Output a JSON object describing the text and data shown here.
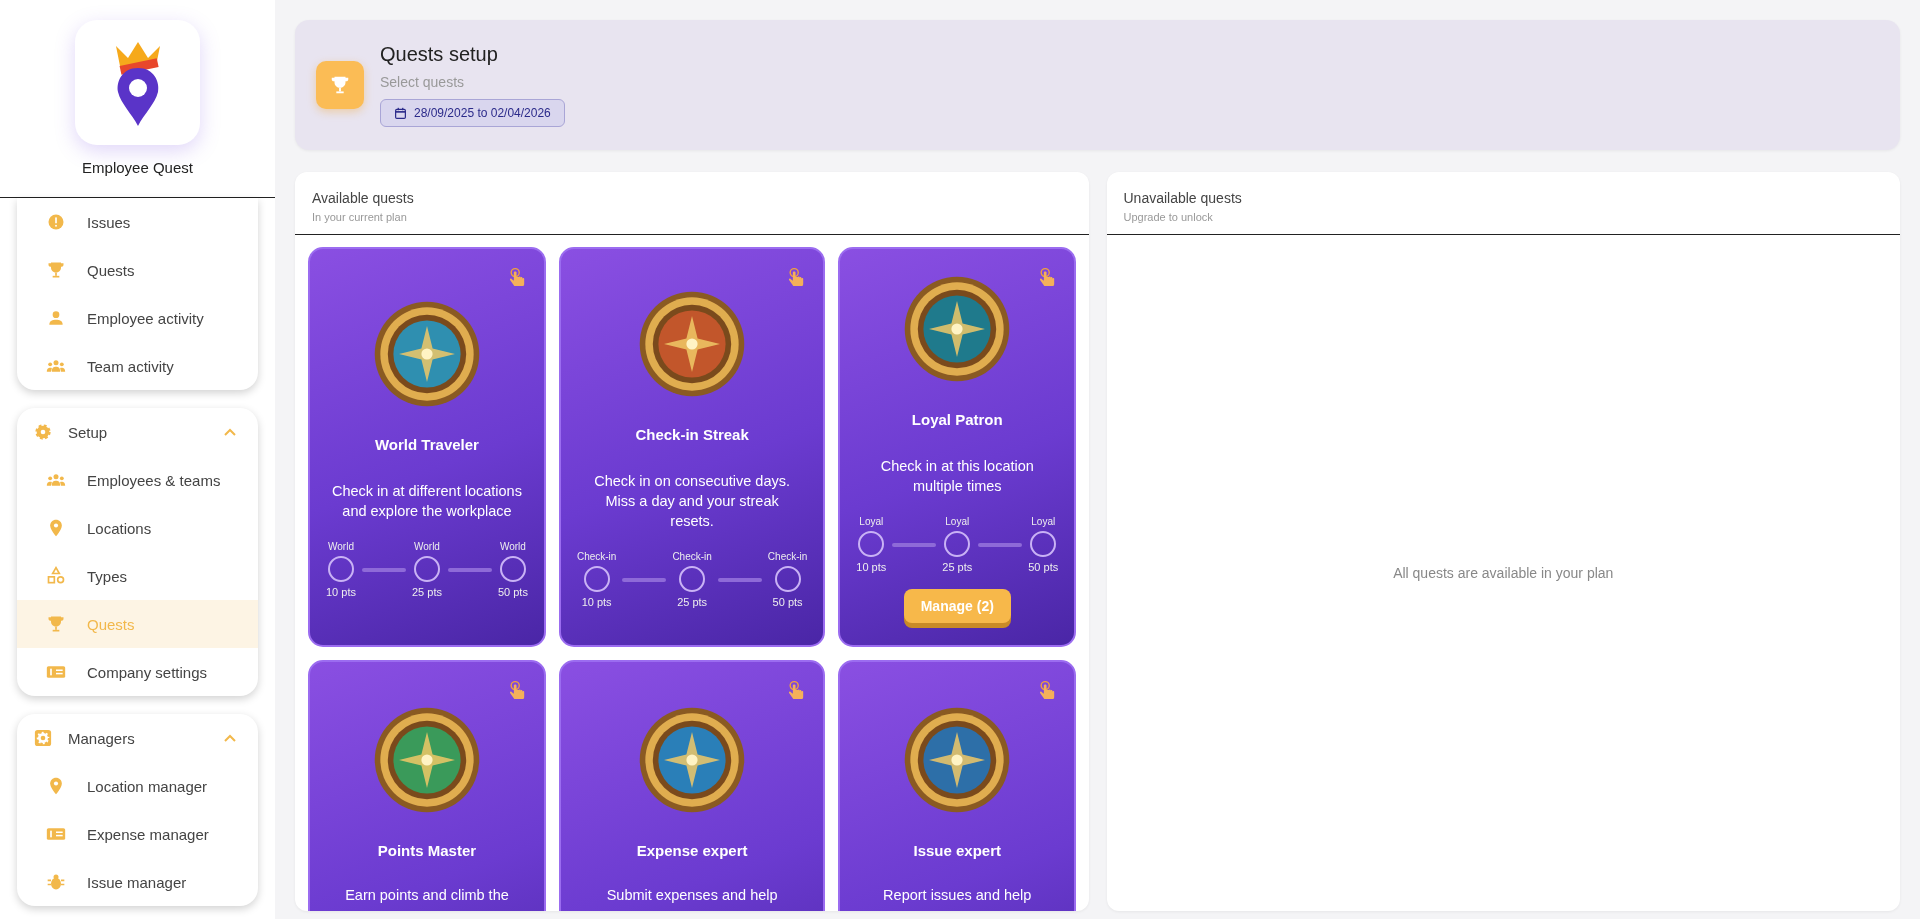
{
  "app": {
    "name": "Employee Quest"
  },
  "sidebar": {
    "groups": [
      {
        "items": [
          {
            "label": "Issues",
            "selected": false
          },
          {
            "label": "Quests",
            "selected": false
          },
          {
            "label": "Employee activity",
            "selected": false
          },
          {
            "label": "Team activity",
            "selected": false
          }
        ]
      },
      {
        "title": "Setup",
        "expanded": true,
        "items": [
          {
            "label": "Employees & teams",
            "selected": false
          },
          {
            "label": "Locations",
            "selected": false
          },
          {
            "label": "Types",
            "selected": false
          },
          {
            "label": "Quests",
            "selected": true
          },
          {
            "label": "Company settings",
            "selected": false
          }
        ]
      },
      {
        "title": "Managers",
        "expanded": true,
        "items": [
          {
            "label": "Location manager",
            "selected": false
          },
          {
            "label": "Expense manager",
            "selected": false
          },
          {
            "label": "Issue manager",
            "selected": false
          }
        ]
      }
    ]
  },
  "header": {
    "title": "Quests setup",
    "subtitle": "Select quests",
    "date_range": "28/09/2025 to 02/04/2026"
  },
  "available": {
    "title": "Available quests",
    "subtitle": "In your current plan",
    "quests": [
      {
        "name": "World Traveler",
        "description": "Check in at different locations and explore the workplace",
        "milestones": [
          {
            "label": "World",
            "points": "10 pts"
          },
          {
            "label": "World",
            "points": "25 pts"
          },
          {
            "label": "World",
            "points": "50 pts"
          }
        ]
      },
      {
        "name": "Check-in Streak",
        "description": "Check in on consecutive days. Miss a day and your streak resets.",
        "milestones": [
          {
            "label": "Check-in",
            "points": "10 pts"
          },
          {
            "label": "Check-in",
            "points": "25 pts"
          },
          {
            "label": "Check-in",
            "points": "50 pts"
          }
        ]
      },
      {
        "name": "Loyal Patron",
        "description": "Check in at this location multiple times",
        "milestones": [
          {
            "label": "Loyal",
            "points": "10 pts"
          },
          {
            "label": "Loyal",
            "points": "25 pts"
          },
          {
            "label": "Loyal",
            "points": "50 pts"
          }
        ],
        "manage_button": "Manage (2)"
      },
      {
        "name": "Points Master",
        "description": "Earn points and climb the"
      },
      {
        "name": "Expense expert",
        "description": "Submit expenses and help"
      },
      {
        "name": "Issue expert",
        "description": "Report issues and help"
      }
    ]
  },
  "unavailable": {
    "title": "Unavailable quests",
    "subtitle": "Upgrade to unlock",
    "empty_message": "All quests are available in your plan"
  }
}
